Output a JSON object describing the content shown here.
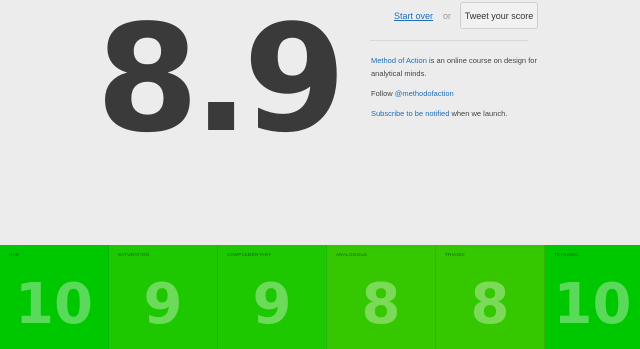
{
  "score": "8.9",
  "actions": {
    "start_over": "Start over",
    "or": "or",
    "tweet": "Tweet your score"
  },
  "info": {
    "course_link": "Method of Action",
    "course_text": " is an online course on design for analytical minds.",
    "follow_text": "Follow ",
    "follow_handle": "@methodofaction",
    "subscribe_link": "Subscribe to be notified",
    "subscribe_text": " when we launch."
  },
  "tiles": [
    {
      "label": "HUE",
      "value": "10",
      "color": "#00c800"
    },
    {
      "label": "SATURATION",
      "value": "9",
      "color": "#1ec800"
    },
    {
      "label": "COMPLEMENTARY",
      "value": "9",
      "color": "#1ec800"
    },
    {
      "label": "ANALOGOUS",
      "value": "8",
      "color": "#35c800"
    },
    {
      "label": "TRIADIC",
      "value": "8",
      "color": "#35c800"
    },
    {
      "label": "TETRADIC",
      "value": "10",
      "color": "#00c800"
    }
  ]
}
